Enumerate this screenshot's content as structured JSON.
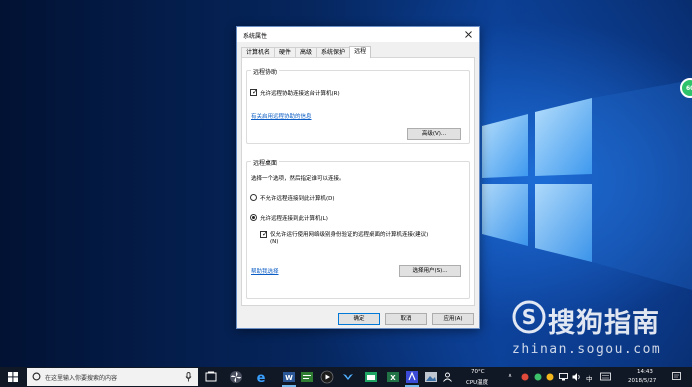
{
  "dialog": {
    "title": "系统属性",
    "tabs": [
      {
        "label": "计算机名",
        "active": false
      },
      {
        "label": "硬件",
        "active": false
      },
      {
        "label": "高级",
        "active": false
      },
      {
        "label": "系统保护",
        "active": false
      },
      {
        "label": "远程",
        "active": true
      }
    ],
    "remote_assistance": {
      "group_title": "远程协助",
      "allow_checkbox_label": "允许远程协助连接这台计算机(R)",
      "allow_checked": true,
      "info_link": "有关启用远程协助的信息",
      "advanced_button": "高级(V)..."
    },
    "remote_desktop": {
      "group_title": "远程桌面",
      "instruction": "选择一个选项，然后指定谁可以连接。",
      "option_disallow": "不允许远程连接到此计算机(D)",
      "option_allow": "允许远程连接到此计算机(L)",
      "selected_option": "allow",
      "nla_label_line1": "仅允许运行使用网络级别身份验证的远程桌面的计算机连接(建议)",
      "nla_label_line2": "(N)",
      "nla_checked": true,
      "help_link": "帮助我选择",
      "select_users_button": "选择用户(S)..."
    },
    "buttons": {
      "ok": "确定",
      "cancel": "取消",
      "apply": "应用(A)"
    }
  },
  "taskbar": {
    "search_placeholder": "在这里输入你要搜索的内容",
    "apps": [
      "task-view",
      "fan-app",
      "edge",
      "word",
      "planner",
      "media-player",
      "bird-app",
      "calendar",
      "excel",
      "screenshot",
      "image-viewer"
    ],
    "weather": {
      "temp": "70°C",
      "label": "CPU温度"
    },
    "ime": "中",
    "clock": {
      "time": "14:43",
      "date": "2018/5/27"
    }
  },
  "watermark": {
    "brand": "搜狗指南",
    "url": "zhinan.sogou.com"
  },
  "colors": {
    "accent": "#0078d7",
    "link": "#0b5cc4",
    "taskbar": "#101725"
  }
}
